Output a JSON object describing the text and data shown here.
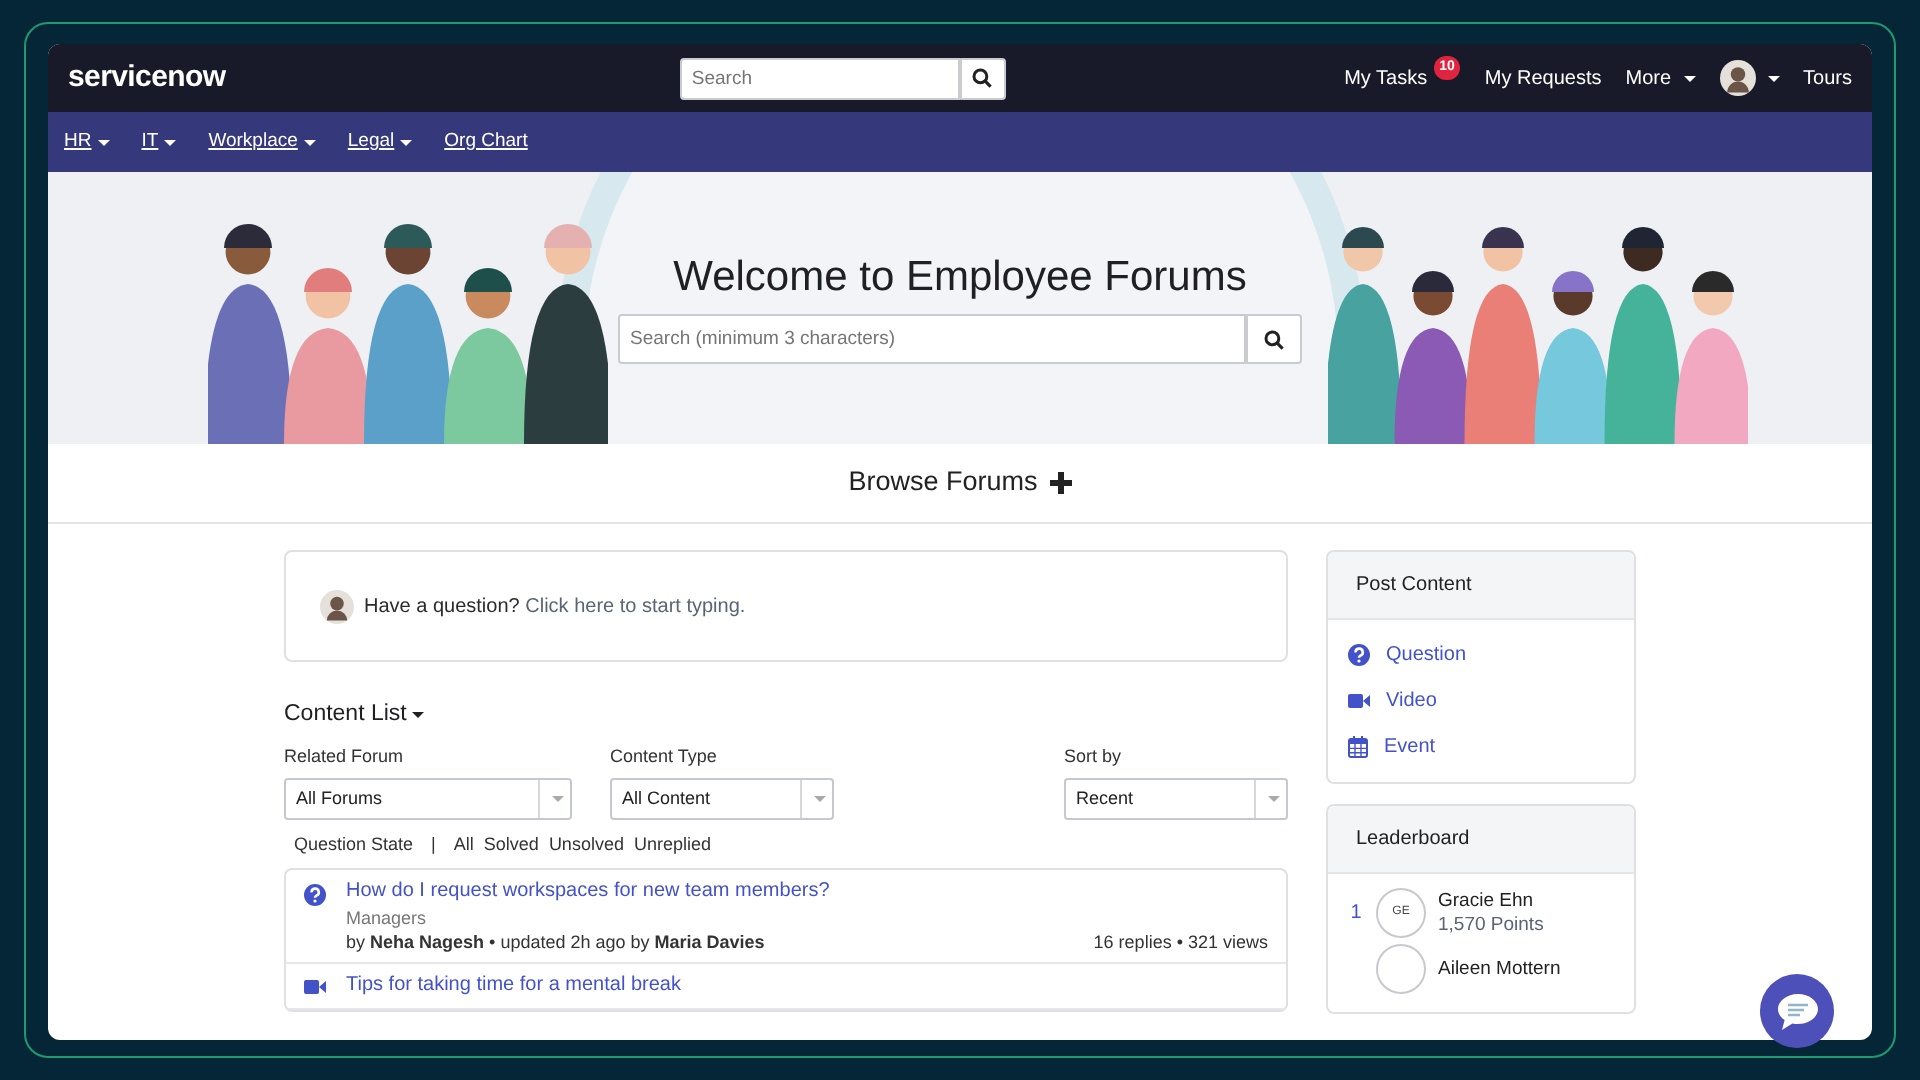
{
  "brand": {
    "logo": "servicenow"
  },
  "header": {
    "search": {
      "placeholder": "Search"
    },
    "links": [
      {
        "kind": "link",
        "label": "My Tasks",
        "badge": "10"
      },
      {
        "kind": "link",
        "label": "My Requests"
      },
      {
        "kind": "dropdown",
        "label": "More"
      },
      {
        "kind": "avatar"
      },
      {
        "kind": "link",
        "label": "Tours"
      }
    ]
  },
  "nav": {
    "items": [
      {
        "label": "HR",
        "dropdown": true
      },
      {
        "label": "IT",
        "dropdown": true
      },
      {
        "label": "Workplace",
        "dropdown": true
      },
      {
        "label": "Legal",
        "dropdown": true
      },
      {
        "label": "Org Chart",
        "dropdown": false
      }
    ]
  },
  "hero": {
    "title": "Welcome to Employee Forums",
    "search": {
      "placeholder": "Search (minimum 3 characters)"
    }
  },
  "browse": {
    "label": "Browse Forums"
  },
  "ask": {
    "prompt": "Have a question?",
    "link": "Click here to start typing."
  },
  "content_list": {
    "title": "Content List",
    "filters": [
      {
        "label": "Related Forum",
        "value": "All Forums"
      },
      {
        "label": "Content Type",
        "value": "All Content"
      }
    ],
    "sort": {
      "label": "Sort by",
      "value": "Recent"
    },
    "question_state": {
      "label": "Question State",
      "separator": "|",
      "options": [
        "All",
        "Solved",
        "Unsolved",
        "Unreplied"
      ]
    },
    "posts": [
      {
        "kind": "question",
        "title": "How do I request workspaces for new team members?",
        "forum": "Managers",
        "byline": "by **Neha Nagesh** • updated 2h ago by **Maria Davies**",
        "stats": "16 replies • 321 views"
      },
      {
        "kind": "video",
        "title": "Tips for taking time for a mental break"
      }
    ]
  },
  "post_content": {
    "title": "Post Content",
    "items": [
      {
        "kind": "question",
        "label": "Question"
      },
      {
        "kind": "video",
        "label": "Video"
      },
      {
        "kind": "event",
        "label": "Event"
      }
    ]
  },
  "leaderboard": {
    "title": "Leaderboard",
    "entries": [
      {
        "rank": "1",
        "initials": "GE",
        "name": "Gracie Ehn",
        "points": "1,570 Points"
      },
      {
        "name": "Aileen Mottern"
      }
    ]
  }
}
